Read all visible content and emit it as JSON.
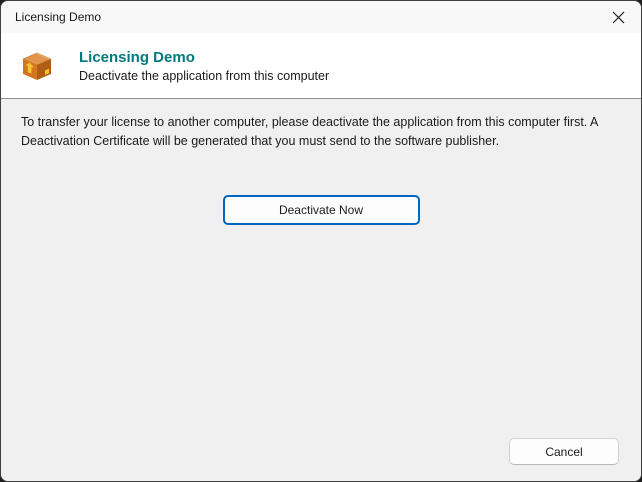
{
  "window": {
    "title": "Licensing Demo"
  },
  "header": {
    "title": "Licensing Demo",
    "subtitle": "Deactivate the application from this computer",
    "icon": "package-box-icon"
  },
  "content": {
    "instruction_text": "To transfer your license to another computer, please deactivate the application from this computer first. A Deactivation Certificate will be generated that you must send to the software publisher.",
    "deactivate_button_label": "Deactivate Now"
  },
  "footer": {
    "cancel_button_label": "Cancel"
  },
  "colors": {
    "header_title_teal": "#00797d",
    "focus_button_border_blue": "#0067c0",
    "titlebar_bg": "#f8f8f9",
    "header_bg": "#ffffff",
    "content_bg": "#f0f0f0",
    "window_border": "#3f3f3f",
    "icon_orange_top": "#e2954a",
    "icon_orange_front": "#d3771f",
    "icon_orange_side": "#b05e15",
    "icon_arrow_yellow": "#f4c430"
  }
}
